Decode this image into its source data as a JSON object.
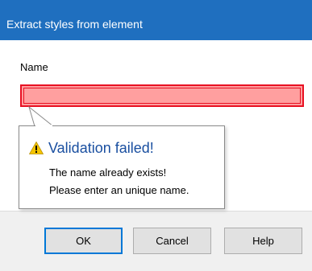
{
  "dialog": {
    "title": "Extract styles from element",
    "name_label": "Name",
    "name_value": "",
    "colors": {
      "titlebar": "#1f6fbf",
      "input_error_bg": "#ff9f9f",
      "input_error_border": "#e81123",
      "tooltip_title": "#1a4fa0",
      "warning": "#f5c400"
    }
  },
  "validation": {
    "icon": "warning-icon",
    "title": "Validation failed!",
    "line1": "The name already exists!",
    "line2": "Please enter an unique name."
  },
  "buttons": {
    "ok": "OK",
    "cancel": "Cancel",
    "help": "Help"
  }
}
